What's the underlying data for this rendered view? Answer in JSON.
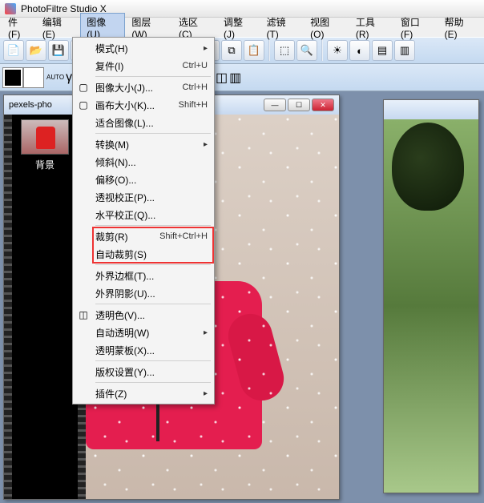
{
  "app_title": "PhotoFiltre Studio X",
  "menubar": {
    "items": [
      "件(F)",
      "编辑(E)",
      "图像(U)",
      "图层(W)",
      "选区(C)",
      "调整(J)",
      "滤镜(T)",
      "视图(O)",
      "工具(R)",
      "窗口(F)",
      "帮助(E)"
    ],
    "active_index": 2
  },
  "dropdown": {
    "groups": [
      [
        {
          "label": "模式(H)",
          "sub": true
        },
        {
          "label": "复件(I)",
          "shortcut": "Ctrl+U"
        }
      ],
      [
        {
          "label": "图像大小(J)...",
          "shortcut": "Ctrl+H",
          "icon": "image-size-icon"
        },
        {
          "label": "画布大小(K)...",
          "shortcut": "Shift+H",
          "icon": "canvas-size-icon"
        },
        {
          "label": "适合图像(L)..."
        }
      ],
      [
        {
          "label": "转换(M)",
          "sub": true
        },
        {
          "label": "倾斜(N)..."
        },
        {
          "label": "偏移(O)..."
        },
        {
          "label": "透视校正(P)..."
        },
        {
          "label": "水平校正(Q)..."
        }
      ],
      [
        {
          "label": "裁剪(R)",
          "shortcut": "Shift+Ctrl+H",
          "highlight": true
        },
        {
          "label": "自动裁剪(S)",
          "highlight": true
        }
      ],
      [
        {
          "label": "外界边框(T)..."
        },
        {
          "label": "外界阴影(U)..."
        }
      ],
      [
        {
          "label": "透明色(V)...",
          "icon": "transparency-icon"
        },
        {
          "label": "自动透明(W)",
          "sub": true
        },
        {
          "label": "透明蒙板(X)..."
        }
      ],
      [
        {
          "label": "版权设置(Y)..."
        }
      ],
      [
        {
          "label": "插件(Z)",
          "sub": true
        }
      ]
    ]
  },
  "document1": {
    "title": "pexels-pho",
    "layer_label": "背景"
  },
  "colors": {
    "fg": "#000000",
    "bg": "#ffffff"
  }
}
